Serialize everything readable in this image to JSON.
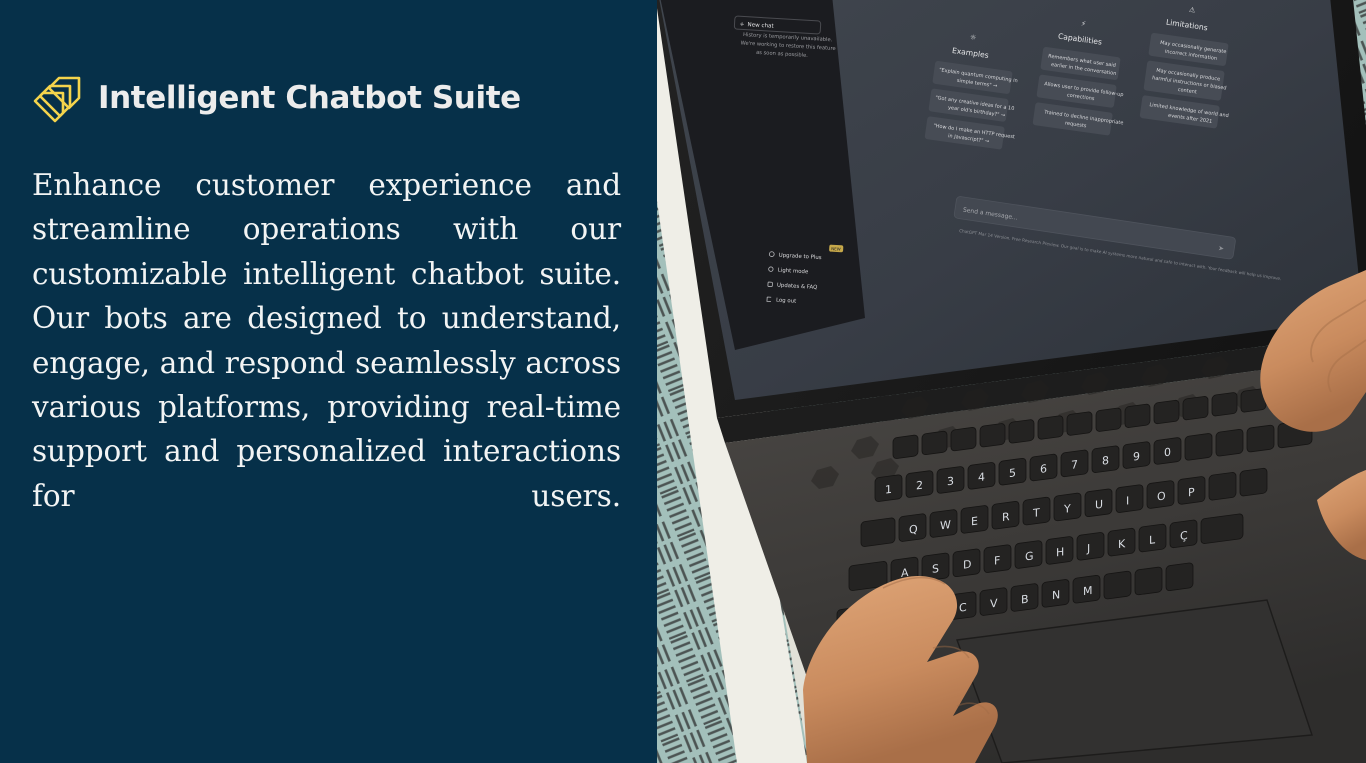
{
  "theme": {
    "panel_bg": "#063049",
    "accent_yellow": "#f4d44c",
    "title_color": "#ececec",
    "body_color": "#f2f4f4"
  },
  "left_panel": {
    "logo_icon": "layered-chevron-logo-icon",
    "title": "Intelligent Chatbot Suite",
    "body": "Enhance customer experience and streamline operations with our customizable intelligent chatbot suite. Our bots are designed to understand, engage, and respond seamlessly across various platforms, providing real-time support and personalized interactions for users."
  },
  "photo": {
    "description": "person-typing-on-laptop-photo",
    "surface_color": "#9fbcb8",
    "table_edge_color": "#efefe8",
    "laptop_body_color": "#3a3a3c",
    "screen": {
      "sidebar": {
        "new_chat_label": "New chat",
        "new_chat_icon": "plus-icon",
        "history_notice": "History is temporarily unavailable. We're working to restore this feature as soon as possible.",
        "menu_items": [
          {
            "label": "Upgrade to Plus",
            "icon": "user-plus-icon",
            "badge": "NEW"
          },
          {
            "label": "Light mode",
            "icon": "sun-icon",
            "badge": ""
          },
          {
            "label": "Updates & FAQ",
            "icon": "external-link-icon",
            "badge": ""
          },
          {
            "label": "Log out",
            "icon": "logout-icon",
            "badge": ""
          }
        ]
      },
      "columns": [
        {
          "heading": "Examples",
          "icon": "sun-icon",
          "cards": [
            "\"Explain quantum computing in simple terms\" →",
            "\"Got any creative ideas for a 10 year old's birthday?\" →",
            "\"How do I make an HTTP request in Javascript?\" →"
          ]
        },
        {
          "heading": "Capabilities",
          "icon": "lightning-icon",
          "cards": [
            "Remembers what user said earlier in the conversation",
            "Allows user to provide follow-up corrections",
            "Trained to decline inappropriate requests"
          ]
        },
        {
          "heading": "Limitations",
          "icon": "warning-icon",
          "cards": [
            "May occasionally generate incorrect information",
            "May occasionally produce harmful instructions or biased content",
            "Limited knowledge of world and events after 2021"
          ]
        }
      ],
      "composer": {
        "placeholder": "Send a message...",
        "send_icon": "send-icon"
      },
      "footer_note": "ChatGPT Mar 14 Version. Free Research Preview. Our goal is to make AI systems more natural and safe to interact with. Your feedback will help us improve."
    }
  }
}
